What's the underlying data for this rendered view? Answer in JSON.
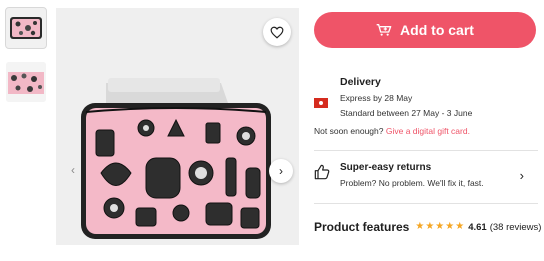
{
  "gallery": {
    "thumbnails": [
      {
        "name": "thumb-laptop-sleeve",
        "active": true
      },
      {
        "name": "thumb-pattern-closeup",
        "active": false
      }
    ],
    "favorite_icon": "heart-outline-icon",
    "prev_icon": "chevron-left-icon",
    "next_icon": "chevron-right-icon"
  },
  "cart": {
    "label": "Add to cart",
    "icon": "cart-plus-icon",
    "color": "#ef5468"
  },
  "delivery": {
    "title": "Delivery",
    "express": "Express by 28 May",
    "standard": "Standard between 27 May - 3 June",
    "note_prefix": "Not soon enough?",
    "gift_link": "Give a digital gift card.",
    "flag_icon": "hong-kong-flag-icon"
  },
  "returns": {
    "title": "Super-easy returns",
    "subtitle": "Problem? No problem. We'll fix it, fast.",
    "icon": "thumbs-up-icon"
  },
  "features": {
    "title": "Product features",
    "rating": "4.61",
    "reviews": "(38 reviews)",
    "stars": 5,
    "star_color": "#f5a623"
  }
}
